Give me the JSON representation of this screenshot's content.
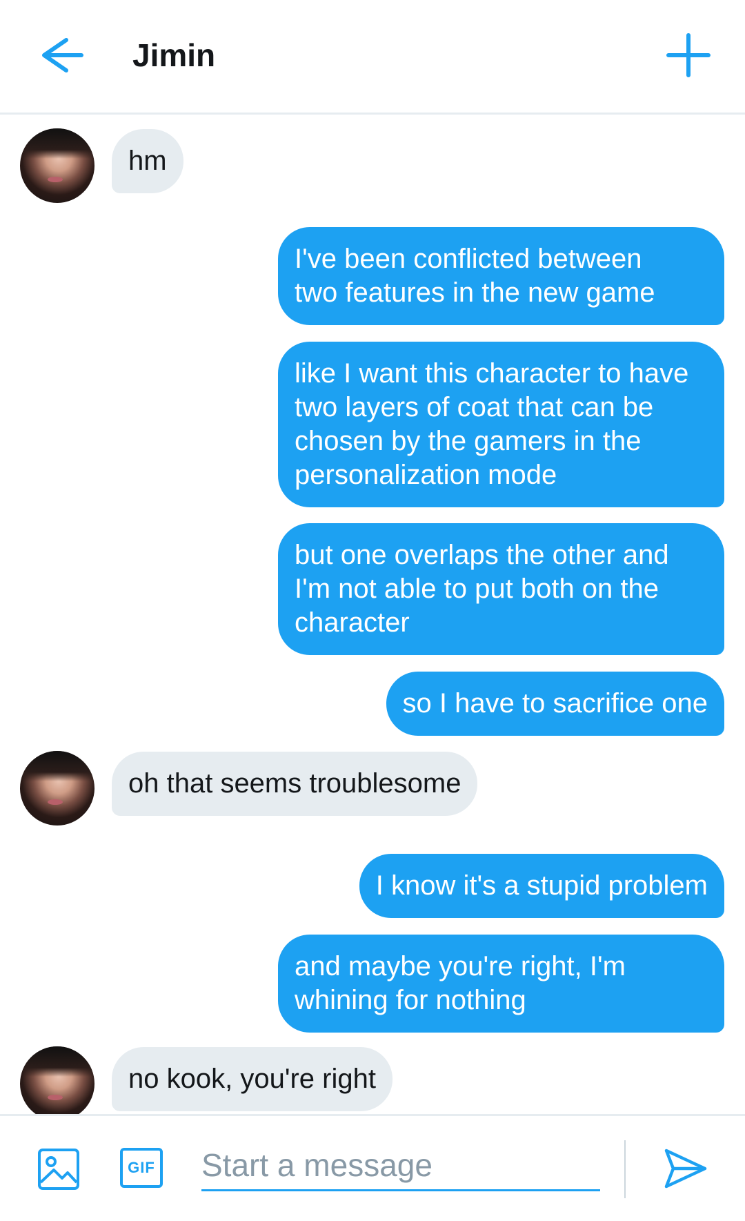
{
  "header": {
    "title": "Jimin"
  },
  "icons": {
    "back": "arrow-left-icon",
    "new": "plus-icon",
    "image": "image-icon",
    "gif": "gif-icon",
    "send": "send-icon"
  },
  "colors": {
    "accent": "#1da1f2",
    "incoming_bubble": "#e6ecf0",
    "text": "#14171a",
    "placeholder": "#8899a6"
  },
  "messages": [
    {
      "sender": "Jimin",
      "lines": [
        "hm"
      ]
    },
    {
      "sender": "me",
      "lines": [
        "I've been conflicted between",
        "two features in the new game"
      ]
    },
    {
      "sender": "me",
      "lines": [
        "like I want this character to have",
        "two layers of coat that can be",
        "chosen by the gamers in the",
        "personalization mode"
      ]
    },
    {
      "sender": "me",
      "lines": [
        "but one overlaps the other and",
        "I'm not able to put both on the",
        "character"
      ]
    },
    {
      "sender": "me",
      "lines": [
        "so I have to sacrifice one"
      ]
    },
    {
      "sender": "Jimin",
      "lines": [
        "oh that seems troublesome"
      ]
    },
    {
      "sender": "me",
      "lines": [
        "I know it's a stupid problem"
      ]
    },
    {
      "sender": "me",
      "lines": [
        "and maybe you're right, I'm",
        "whining for nothing"
      ]
    },
    {
      "sender": "Jimin",
      "lines": [
        "no kook, you're right"
      ]
    }
  ],
  "composer": {
    "gif_label": "GIF",
    "placeholder": "Start a message",
    "value": ""
  }
}
